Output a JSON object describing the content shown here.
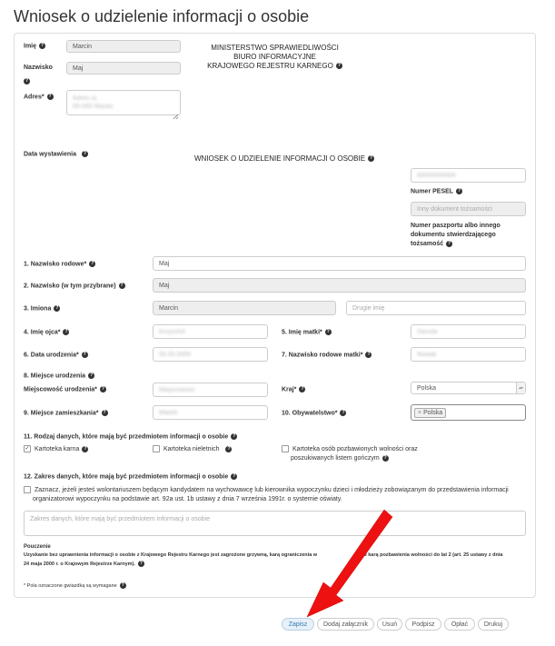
{
  "title": "Wniosek o udzielenie informacji o osobie",
  "ministry": {
    "line1": "MINISTERSTWO SPRAWIEDLIWOŚCI",
    "line2": "BIURO INFORMACYJNE",
    "line3": "KRAJOWEGO REJESTRU KARNEGO"
  },
  "top": {
    "imie_label": "Imię",
    "imie_value": "Marcin",
    "nazwisko_label": "Nazwisko",
    "nazwisko_value": "Maj",
    "adres_label": "Adres*",
    "adres_line1": "Adres ul.",
    "adres_line2": "00-000 Miasto"
  },
  "data_wystawienia_label": "Data wystawienia",
  "wniosek_heading": "WNIOSEK O UDZIELENIE INFORMACJI O OSOBIE",
  "pesel": {
    "value": "00000000000",
    "label": "Numer PESEL"
  },
  "paszport": {
    "placeholder": "Inny dokument tożsamości",
    "label_line1": "Numer paszportu albo innego",
    "label_line2": "dokumentu stwierdzającego",
    "label_line3": "tożsamość"
  },
  "fields": {
    "nazwisko_rodowe_label": "1. Nazwisko rodowe*",
    "nazwisko_rodowe_value": "Maj",
    "nazwisko_tym_label": "2. Nazwisko (w tym przybrane)",
    "nazwisko_tym_value": "Maj",
    "imiona_label": "3. Imiona",
    "imiona_value": "Marcin",
    "drugie_imie_placeholder": "Drugie imię",
    "imie_ojca_label": "4. Imię ojca*",
    "imie_ojca_value": "Krzysztof",
    "imie_matki_label": "5. Imię matki*",
    "imie_matki_value": "Danuta",
    "data_urodzenia_label": "6. Data urodzenia*",
    "data_urodzenia_value": "00.00.0000",
    "nazwisko_matki_label": "7. Nazwisko rodowe matki*",
    "nazwisko_matki_value": "Nowak",
    "miejsce_urodzenia_label": "8. Miejsce urodzenia",
    "miejscowosc_label": "Miejscowość urodzenia*",
    "miejscowosc_value": "Miejscowość",
    "kraj_label": "Kraj*",
    "kraj_value": "Polska",
    "miejsce_zam_label": "9. Miejsce zamieszkania*",
    "miejsce_zam_value": "Miasto",
    "obywatelstwo_label": "10. Obywatelstwo*",
    "obywatelstwo_tag": "Polska",
    "obywatelstwo_tag_x": "×"
  },
  "section11": {
    "label": "11. Rodzaj danych, które mają być przedmiotem informacji o osobie",
    "cb1": "Kartoteka karna",
    "cb2": "Kartoteka nieletnich",
    "cb3_line1": "Kartoteka osób pozbawionych wolności oraz",
    "cb3_line2": "poszukiwanych listem gończym",
    "check_mark": "✓"
  },
  "section12": {
    "label": "12. Zakres danych, które mają być przedmiotem informacji o osobie",
    "volunteer_line1": "Zaznacz, jeżeli jesteś wolontariuszem będącym kandydatem na wychowawcę lub kierownika wypoczynku dzieci i młodzieży zobowiązanym do przedstawienia informacji",
    "volunteer_line2": "organizatorowi wypoczynku na podstawie art. 92a ust. 1b ustawy z dnia 7 września 1991r. o systemie oświaty.",
    "textarea_placeholder": "Zakres danych, które mają być przedmiotem informacji o osobie"
  },
  "pouczenie": {
    "label": "Pouczenie",
    "line1a": "Uzyskanie bez uprawnienia informacji o osobie z Krajowego Rejestru Karnego jest zagrożone grzywną, karą ograniczenia w",
    "line1b": "bo karą pozbawienia wolności do lat 2 (art. 25 ustawy z dnia",
    "line2": "24 maja 2000 r. o Krajowym Rejestrze Karnym)."
  },
  "required_note": "* Pola oznaczone gwiazdką są wymagane",
  "buttons": {
    "zapisz": "Zapisz",
    "dodaj": "Dodaj załącznik",
    "usun": "Usuń",
    "podpisz": "Podpisz",
    "oplac": "Opłać",
    "drukuj": "Drukuj"
  },
  "help_glyph": "?",
  "select_arrow": "▴▾",
  "colors": {
    "accent": "#337ab7",
    "arrow_red": "#ee1111"
  }
}
